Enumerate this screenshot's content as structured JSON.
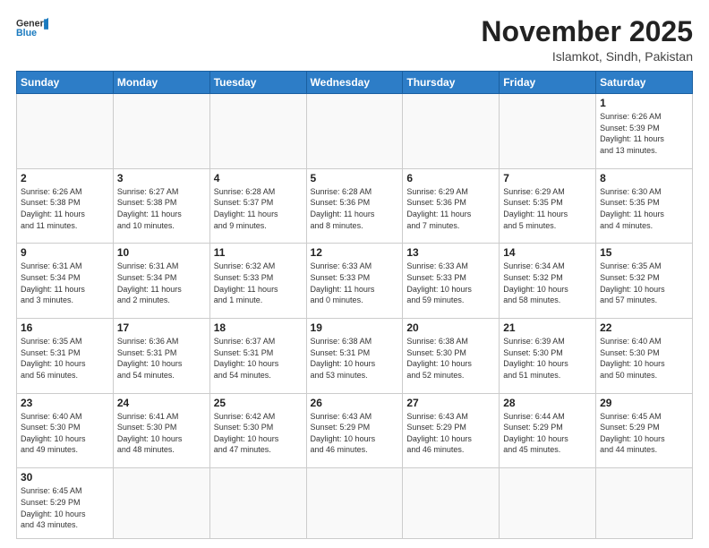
{
  "logo": {
    "text_general": "General",
    "text_blue": "Blue"
  },
  "header": {
    "month_year": "November 2025",
    "location": "Islamkot, Sindh, Pakistan"
  },
  "weekdays": [
    "Sunday",
    "Monday",
    "Tuesday",
    "Wednesday",
    "Thursday",
    "Friday",
    "Saturday"
  ],
  "weeks": [
    [
      {
        "day": "",
        "info": ""
      },
      {
        "day": "",
        "info": ""
      },
      {
        "day": "",
        "info": ""
      },
      {
        "day": "",
        "info": ""
      },
      {
        "day": "",
        "info": ""
      },
      {
        "day": "",
        "info": ""
      },
      {
        "day": "1",
        "info": "Sunrise: 6:26 AM\nSunset: 5:39 PM\nDaylight: 11 hours\nand 13 minutes."
      }
    ],
    [
      {
        "day": "2",
        "info": "Sunrise: 6:26 AM\nSunset: 5:38 PM\nDaylight: 11 hours\nand 11 minutes."
      },
      {
        "day": "3",
        "info": "Sunrise: 6:27 AM\nSunset: 5:38 PM\nDaylight: 11 hours\nand 10 minutes."
      },
      {
        "day": "4",
        "info": "Sunrise: 6:28 AM\nSunset: 5:37 PM\nDaylight: 11 hours\nand 9 minutes."
      },
      {
        "day": "5",
        "info": "Sunrise: 6:28 AM\nSunset: 5:36 PM\nDaylight: 11 hours\nand 8 minutes."
      },
      {
        "day": "6",
        "info": "Sunrise: 6:29 AM\nSunset: 5:36 PM\nDaylight: 11 hours\nand 7 minutes."
      },
      {
        "day": "7",
        "info": "Sunrise: 6:29 AM\nSunset: 5:35 PM\nDaylight: 11 hours\nand 5 minutes."
      },
      {
        "day": "8",
        "info": "Sunrise: 6:30 AM\nSunset: 5:35 PM\nDaylight: 11 hours\nand 4 minutes."
      }
    ],
    [
      {
        "day": "9",
        "info": "Sunrise: 6:31 AM\nSunset: 5:34 PM\nDaylight: 11 hours\nand 3 minutes."
      },
      {
        "day": "10",
        "info": "Sunrise: 6:31 AM\nSunset: 5:34 PM\nDaylight: 11 hours\nand 2 minutes."
      },
      {
        "day": "11",
        "info": "Sunrise: 6:32 AM\nSunset: 5:33 PM\nDaylight: 11 hours\nand 1 minute."
      },
      {
        "day": "12",
        "info": "Sunrise: 6:33 AM\nSunset: 5:33 PM\nDaylight: 11 hours\nand 0 minutes."
      },
      {
        "day": "13",
        "info": "Sunrise: 6:33 AM\nSunset: 5:33 PM\nDaylight: 10 hours\nand 59 minutes."
      },
      {
        "day": "14",
        "info": "Sunrise: 6:34 AM\nSunset: 5:32 PM\nDaylight: 10 hours\nand 58 minutes."
      },
      {
        "day": "15",
        "info": "Sunrise: 6:35 AM\nSunset: 5:32 PM\nDaylight: 10 hours\nand 57 minutes."
      }
    ],
    [
      {
        "day": "16",
        "info": "Sunrise: 6:35 AM\nSunset: 5:31 PM\nDaylight: 10 hours\nand 56 minutes."
      },
      {
        "day": "17",
        "info": "Sunrise: 6:36 AM\nSunset: 5:31 PM\nDaylight: 10 hours\nand 54 minutes."
      },
      {
        "day": "18",
        "info": "Sunrise: 6:37 AM\nSunset: 5:31 PM\nDaylight: 10 hours\nand 54 minutes."
      },
      {
        "day": "19",
        "info": "Sunrise: 6:38 AM\nSunset: 5:31 PM\nDaylight: 10 hours\nand 53 minutes."
      },
      {
        "day": "20",
        "info": "Sunrise: 6:38 AM\nSunset: 5:30 PM\nDaylight: 10 hours\nand 52 minutes."
      },
      {
        "day": "21",
        "info": "Sunrise: 6:39 AM\nSunset: 5:30 PM\nDaylight: 10 hours\nand 51 minutes."
      },
      {
        "day": "22",
        "info": "Sunrise: 6:40 AM\nSunset: 5:30 PM\nDaylight: 10 hours\nand 50 minutes."
      }
    ],
    [
      {
        "day": "23",
        "info": "Sunrise: 6:40 AM\nSunset: 5:30 PM\nDaylight: 10 hours\nand 49 minutes."
      },
      {
        "day": "24",
        "info": "Sunrise: 6:41 AM\nSunset: 5:30 PM\nDaylight: 10 hours\nand 48 minutes."
      },
      {
        "day": "25",
        "info": "Sunrise: 6:42 AM\nSunset: 5:30 PM\nDaylight: 10 hours\nand 47 minutes."
      },
      {
        "day": "26",
        "info": "Sunrise: 6:43 AM\nSunset: 5:29 PM\nDaylight: 10 hours\nand 46 minutes."
      },
      {
        "day": "27",
        "info": "Sunrise: 6:43 AM\nSunset: 5:29 PM\nDaylight: 10 hours\nand 46 minutes."
      },
      {
        "day": "28",
        "info": "Sunrise: 6:44 AM\nSunset: 5:29 PM\nDaylight: 10 hours\nand 45 minutes."
      },
      {
        "day": "29",
        "info": "Sunrise: 6:45 AM\nSunset: 5:29 PM\nDaylight: 10 hours\nand 44 minutes."
      }
    ],
    [
      {
        "day": "30",
        "info": "Sunrise: 6:45 AM\nSunset: 5:29 PM\nDaylight: 10 hours\nand 43 minutes."
      },
      {
        "day": "",
        "info": ""
      },
      {
        "day": "",
        "info": ""
      },
      {
        "day": "",
        "info": ""
      },
      {
        "day": "",
        "info": ""
      },
      {
        "day": "",
        "info": ""
      },
      {
        "day": "",
        "info": ""
      }
    ]
  ]
}
